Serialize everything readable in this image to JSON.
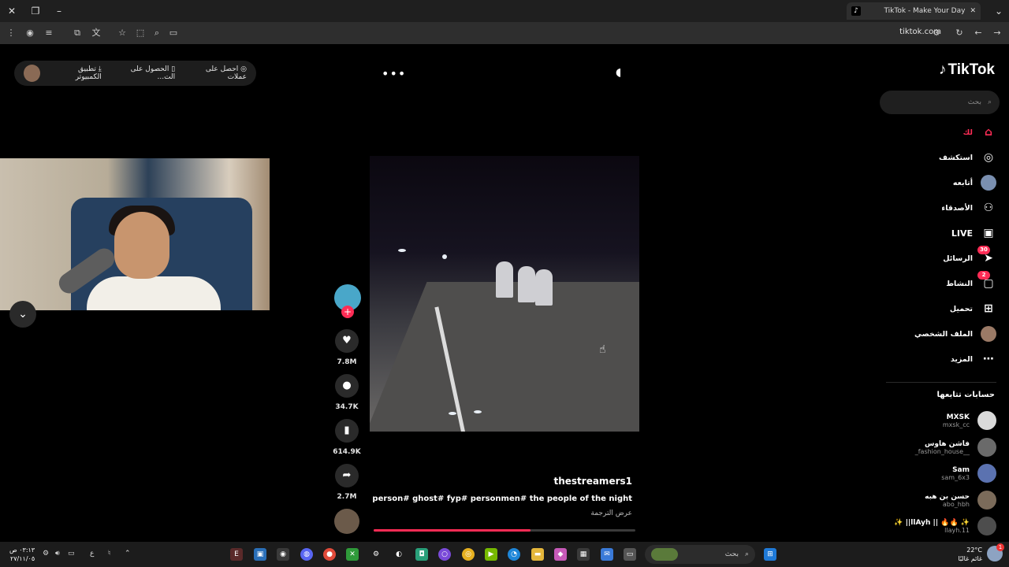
{
  "browser": {
    "tab_title": "TikTok - Make Your Day",
    "tab_icon": "tiktok-icon",
    "url": "tiktok.com"
  },
  "topbar": {
    "coins_label": "احصل على عملات",
    "get_app_label": "الحصول على الت...",
    "desktop_app_label": "تطبيق الكمبيوتر"
  },
  "sidebar": {
    "logo": "TikTok",
    "search_placeholder": "بحث",
    "nav": [
      {
        "label": "لك",
        "icon": "home-icon",
        "active": true
      },
      {
        "label": "استكشف",
        "icon": "compass-icon"
      },
      {
        "label": "أتابعه",
        "icon": "avatar-icon"
      },
      {
        "label": "الأصدقاء",
        "icon": "friends-icon"
      },
      {
        "label": "LIVE",
        "icon": "live-icon"
      },
      {
        "label": "الرسائل",
        "icon": "send-icon",
        "badge": "30"
      },
      {
        "label": "النشاط",
        "icon": "chat-icon",
        "badge": "2"
      },
      {
        "label": "تحميل",
        "icon": "plus-square-icon"
      },
      {
        "label": "الملف الشخصي",
        "icon": "avatar-icon"
      },
      {
        "label": "المزيد",
        "icon": "more-icon"
      }
    ],
    "following_title": "حسابات تتابعها",
    "accounts": [
      {
        "name": "MXSK",
        "handle": "mxsk_cc"
      },
      {
        "name": "فاشن هاوس",
        "handle": "_fashion_house__"
      },
      {
        "name": "Sam",
        "handle": "sam_6x3"
      },
      {
        "name": "حسن بن هبه",
        "handle": "abo_hbh"
      },
      {
        "name": "✨ ||llAyh || 🔥🔥 ✨",
        "handle": "llayh.11"
      }
    ]
  },
  "video": {
    "likes": "7.8M",
    "comments": "34.7K",
    "saves": "614.9K",
    "shares": "2.7M",
    "username": "thestreamers1",
    "caption": "person# ghost# fyp# personmen# the people of the night",
    "translate_label": "عرض الترجمة",
    "progress": 0.6
  },
  "taskbar": {
    "search_placeholder": "بحث",
    "time": "٠٣:١٣ ص",
    "date": "٢٧/١١/٠٥",
    "lang": "ع",
    "temperature": "22°C",
    "weather_text": "غائم غالبًا",
    "notification_count": "1"
  }
}
